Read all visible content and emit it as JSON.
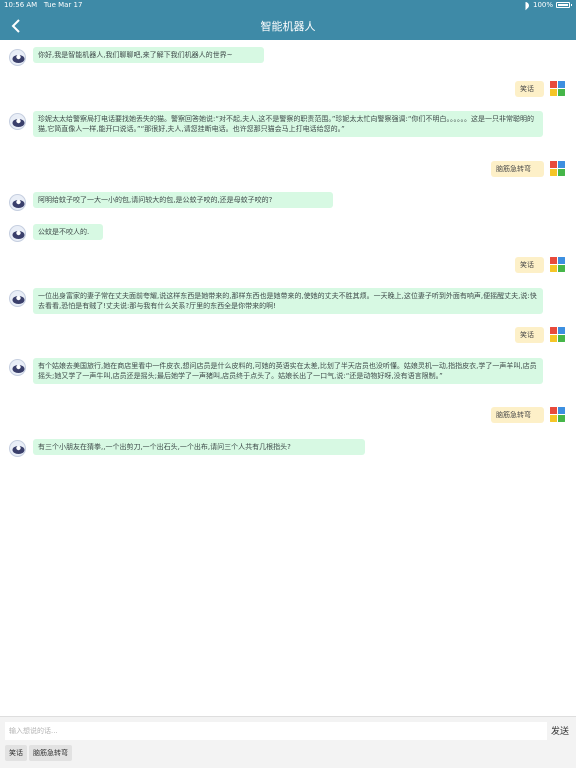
{
  "status_bar": {
    "time": "10:56 AM",
    "date": "Tue Mar 17",
    "battery": "100%"
  },
  "nav": {
    "title": "智能机器人",
    "back_icon": "chevron-left-icon"
  },
  "colors": {
    "nav_bg": "#3e8aa7",
    "bot_bubble": "#d7f9e3",
    "user_bubble": "#fdf0c8"
  },
  "messages": [
    {
      "sender": "bot",
      "text": "你好,我是智能机器人,我们聊聊吧,来了解下我们机器人的世界~"
    },
    {
      "sender": "user",
      "text": "笑话"
    },
    {
      "sender": "bot",
      "text": "珍妮太太给警察局打电话要找她丢失的猫。警察回答她说:“对不起,夫人,这不是警察的职责范围。”珍妮太太忙向警察强调:“你们不明白。。。。。。这是一只非常聪明的猫,它简直像人一样,能开口说话。”“那很好,夫人,请您挂断电话。也许您那只猫会马上打电话给您的。”"
    },
    {
      "sender": "user",
      "text": "脑筋急转弯"
    },
    {
      "sender": "bot",
      "text": "阿明给蚊子咬了一大一小的包,请问较大的包,是公蚊子咬的,还是母蚊子咬的?"
    },
    {
      "sender": "bot",
      "text": "公蚊是不咬人的."
    },
    {
      "sender": "user",
      "text": "笑话"
    },
    {
      "sender": "bot",
      "text": "一位出身富家的妻子常在丈夫面前夸耀,说这样东西是她带来的,那样东西也是她带来的,使她的丈夫不胜其烦。一天晚上,这位妻子听到外面有响声,便摇醒丈夫,说:快去看看,恐怕是有贼了!丈夫说:那与我有什么关系?厅里的东西全是你带来的啊!"
    },
    {
      "sender": "user",
      "text": "笑话"
    },
    {
      "sender": "bot",
      "text": "有个姑娘去美国旅行,她在商店里看中一件皮衣,想问店员是什么皮料的,可她的英语实在太差,比划了半天店员也没听懂。姑娘灵机一动,指指皮衣,学了一声羊叫,店员摇头;她又学了一声牛叫,店员还是摇头;最后她学了一声猪叫,店员终于点头了。姑娘长出了一口气,说:“还是动物好呀,没有语言限制。”"
    },
    {
      "sender": "user",
      "text": "脑筋急转弯"
    },
    {
      "sender": "bot",
      "text": "有三个小朋友在猜拳,,一个出剪刀,一个出石头,一个出布,请问三个人共有几根指头?"
    }
  ],
  "input": {
    "placeholder": "输入想说的话...",
    "value": "",
    "send_label": "发送"
  },
  "quick_replies": [
    "笑话",
    "脑筋急转弯"
  ]
}
